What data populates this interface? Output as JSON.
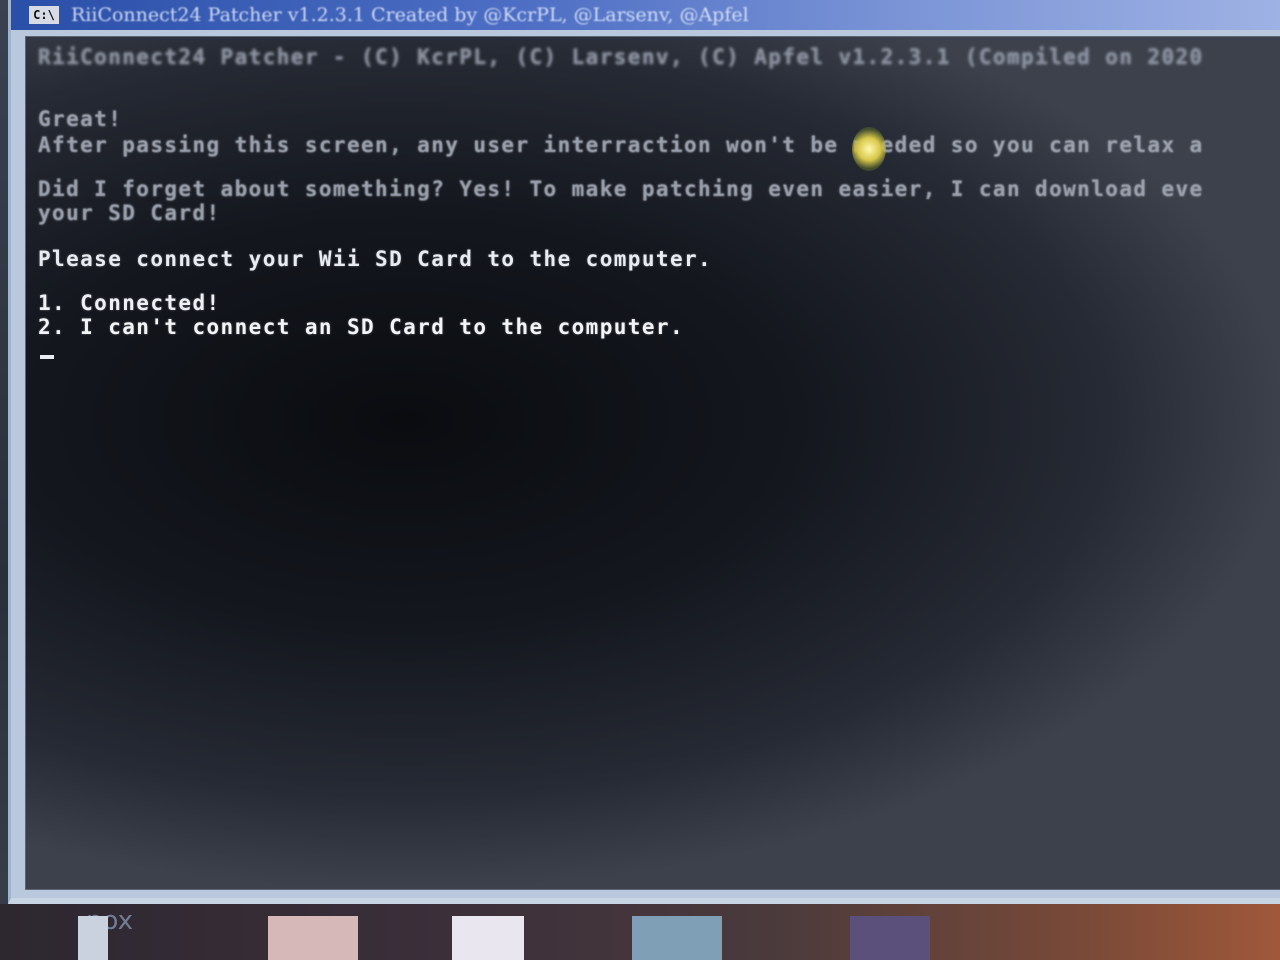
{
  "window": {
    "title": "RiiConnect24 Patcher v1.2.3.1 Created by @KcrPL, @Larsenv, @Apfel",
    "icon_label": "C:\\"
  },
  "console": {
    "header": "RiiConnect24 Patcher - (C) KcrPL, (C) Larsenv, (C) Apfel v1.2.3.1 (Compiled on 2020",
    "lines": [
      "Great!",
      "After passing this screen, any user interraction won't be needed so you can relax a",
      "Did I forget about something? Yes! To make patching even easier, I can download eve",
      "your SD Card!",
      "Please connect your Wii SD Card to the computer.",
      "1. Connected!",
      "2. I can't connect an SD Card to the computer."
    ]
  },
  "desktop": {
    "nox_label": "nox"
  },
  "colors": {
    "console_bg": "#0a0c10",
    "console_text": "#d8dbe2",
    "titlebar": "#2a4fa8"
  }
}
